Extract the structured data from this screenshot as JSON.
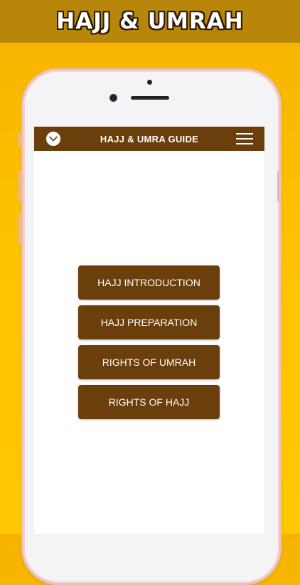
{
  "banner": {
    "title": "HAJJ & UMRAH"
  },
  "app": {
    "title": "HAJJ & UMRA GUIDE",
    "menu_items": [
      {
        "label": "HAJJ INTRODUCTION"
      },
      {
        "label": "HAJJ PREPARATION"
      },
      {
        "label": "RIGHTS OF UMRAH"
      },
      {
        "label": "RIGHTS OF HAJJ"
      }
    ]
  },
  "icons": {
    "back": "chevron-down-icon",
    "menu": "hamburger-menu-icon"
  },
  "colors": {
    "background": "#ffc400",
    "banner": "#b8860a",
    "appbar": "#6b3f0c",
    "button": "#6b3f0c",
    "text": "#ffffff"
  }
}
